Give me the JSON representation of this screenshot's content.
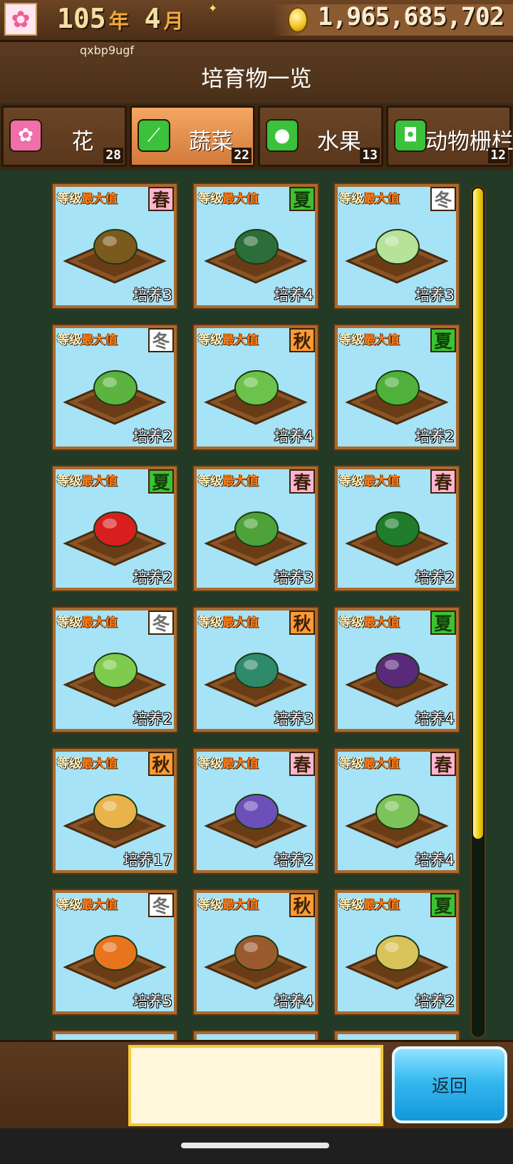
{
  "status": {
    "year": "105",
    "year_unit": "年",
    "month": "4",
    "month_unit": "月",
    "money": "1,965,685,702"
  },
  "header": {
    "username": "qxbp9ugf",
    "title": "培育物一览"
  },
  "tabs": [
    {
      "label": "花",
      "count": "28",
      "icon": "flower-icon",
      "color": "#f06fa8"
    },
    {
      "label": "蔬菜",
      "count": "22",
      "icon": "radish-icon",
      "color": "#39c23a",
      "active": true
    },
    {
      "label": "水果",
      "count": "13",
      "icon": "apple-icon",
      "color": "#39c23a"
    },
    {
      "label": "动物栅栏",
      "count": "12",
      "icon": "cow-icon",
      "color": "#39c23a"
    }
  ],
  "level_label": {
    "prefix": "等级",
    "max": "最大值"
  },
  "items": [
    {
      "plant": "bamboo-shoot",
      "season": "春",
      "season_type": "spring",
      "cultivation": "培养3",
      "color": "#7b5a1e"
    },
    {
      "plant": "pumpkin",
      "season": "夏",
      "season_type": "summer",
      "cultivation": "培养4",
      "color": "#2b6e3a"
    },
    {
      "plant": "chinese-cabbage",
      "season": "冬",
      "season_type": "winter",
      "cultivation": "培养3",
      "color": "#b7e29a"
    },
    {
      "plant": "burdock",
      "season": "冬",
      "season_type": "winter",
      "cultivation": "培养2",
      "color": "#5db33f"
    },
    {
      "plant": "turnip",
      "season": "秋",
      "season_type": "autumn",
      "cultivation": "培养4",
      "color": "#6cc24a"
    },
    {
      "plant": "celery",
      "season": "夏",
      "season_type": "summer",
      "cultivation": "培养2",
      "color": "#4fb03a"
    },
    {
      "plant": "chili-pepper",
      "season": "夏",
      "season_type": "summer",
      "cultivation": "培养2",
      "color": "#d81e1e"
    },
    {
      "plant": "potato",
      "season": "春",
      "season_type": "spring",
      "cultivation": "培养3",
      "color": "#4ea23a"
    },
    {
      "plant": "spinach",
      "season": "春",
      "season_type": "spring",
      "cultivation": "培养2",
      "color": "#1f7d2c"
    },
    {
      "plant": "daikon",
      "season": "冬",
      "season_type": "winter",
      "cultivation": "培养2",
      "color": "#7fcb4e"
    },
    {
      "plant": "broccoli",
      "season": "秋",
      "season_type": "autumn",
      "cultivation": "培养3",
      "color": "#2e8a6a"
    },
    {
      "plant": "eggplant",
      "season": "夏",
      "season_type": "summer",
      "cultivation": "培养4",
      "color": "#5a2a7a"
    },
    {
      "plant": "wheat",
      "season": "秋",
      "season_type": "autumn",
      "cultivation": "培养17",
      "color": "#e9b24a"
    },
    {
      "plant": "red-cabbage",
      "season": "春",
      "season_type": "spring",
      "cultivation": "培养2",
      "color": "#6c4fb8"
    },
    {
      "plant": "cabbage",
      "season": "春",
      "season_type": "spring",
      "cultivation": "培养4",
      "color": "#7cc45a"
    },
    {
      "plant": "carrot",
      "season": "冬",
      "season_type": "winter",
      "cultivation": "培养5",
      "color": "#e8741e"
    },
    {
      "plant": "shiitake",
      "season": "秋",
      "season_type": "autumn",
      "cultivation": "培养4",
      "color": "#9a5a2e"
    },
    {
      "plant": "rice",
      "season": "夏",
      "season_type": "summer",
      "cultivation": "培养2",
      "color": "#d9c25a"
    }
  ],
  "bottom": {
    "back_label": "返回"
  },
  "colors": {
    "card_bg": "#a7e3f6",
    "card_border": "#a96a2f",
    "scroll_thumb": "#f2d31d",
    "back_button": "#35b8ef"
  }
}
